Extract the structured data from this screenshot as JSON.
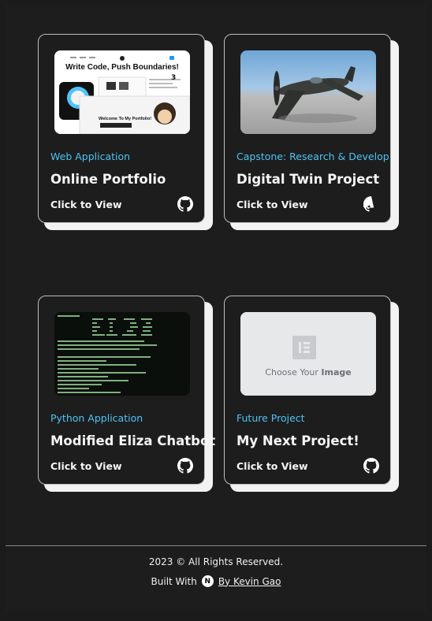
{
  "projects": [
    {
      "category": "Web Application",
      "title": "Online Portfolio",
      "cta": "Click to View",
      "thumb": {
        "heading": "Write Code, Push Boundaries!",
        "welcome": "Welcome To My Portfolio!",
        "stat": "3"
      }
    },
    {
      "category": "Capstone: Research & Develop",
      "title": "Digital Twin Project",
      "cta": "Click to View"
    },
    {
      "category": "Python Application",
      "title": "Modified Eliza Chatbot",
      "cta": "Click to View"
    },
    {
      "category": "Future Project",
      "title": "My Next Project!",
      "cta": "Click to View",
      "thumb": {
        "placeholder_prefix": "Choose Your ",
        "placeholder_bold": "Image"
      }
    }
  ],
  "footer": {
    "copyright": "2023 © All Rights Reserved.",
    "built_with": "Built With",
    "logo_letter": "N",
    "author": "By Kevin Gao"
  },
  "colors": {
    "accent": "#4fc3f7",
    "background": "#1d1d1d",
    "card_shadow": "#f2f2f2"
  }
}
